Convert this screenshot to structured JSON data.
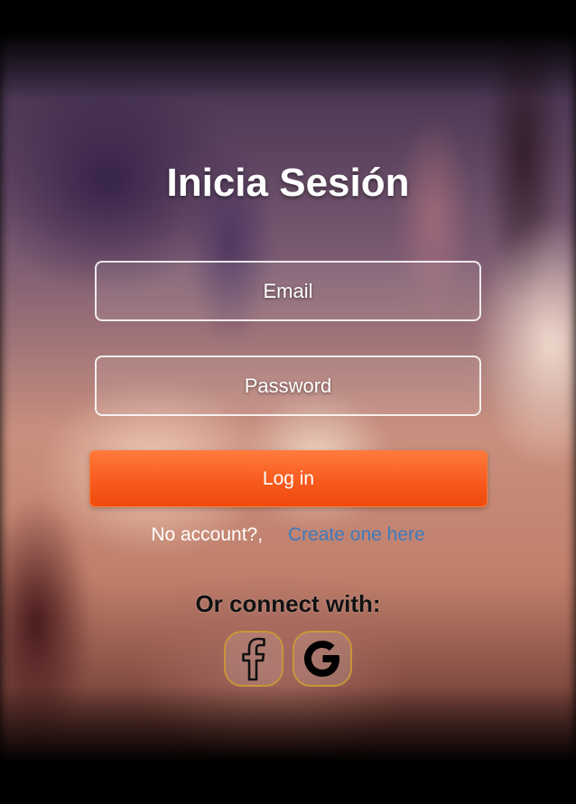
{
  "title": "Inicia Sesión",
  "form": {
    "email_placeholder": "Email",
    "email_value": "",
    "password_placeholder": "Password",
    "password_value": "",
    "login_label": "Log in"
  },
  "signup": {
    "prompt": "No account?,",
    "link_label": "Create one here"
  },
  "social": {
    "title": "Or connect with:",
    "buttons": [
      {
        "icon": "facebook-icon"
      },
      {
        "icon": "google-icon"
      }
    ]
  },
  "colors": {
    "accent": "#f85a1e",
    "link": "#3e7bbd",
    "social_border": "#c9953a"
  }
}
